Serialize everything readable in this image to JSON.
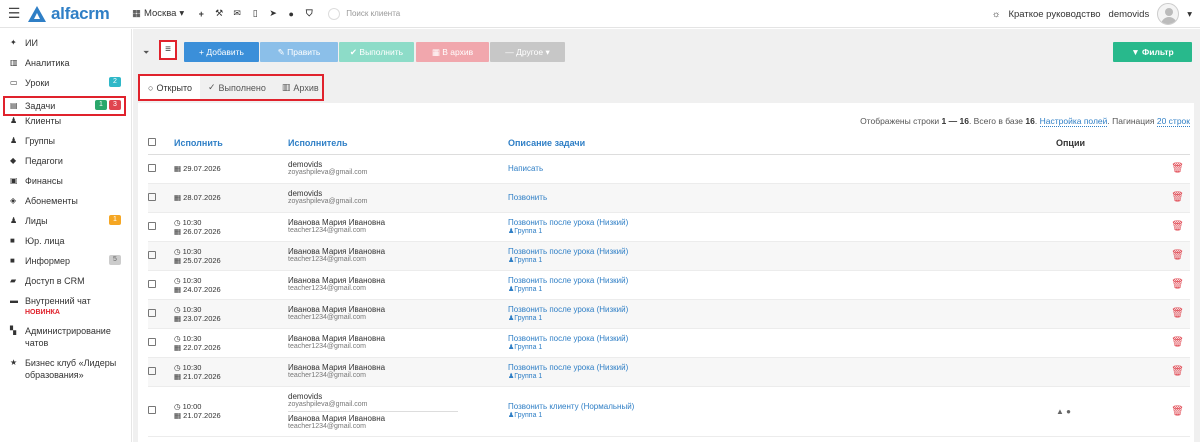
{
  "topbar": {
    "logo": "alfacrm",
    "city": "Москва",
    "search_placeholder": "Поиск клиента",
    "guide": "Краткое руководство",
    "user": "demovids"
  },
  "sidebar": {
    "items": [
      {
        "icon": "magic-icon",
        "label": "ИИ"
      },
      {
        "icon": "chart-icon",
        "label": "Аналитика"
      },
      {
        "icon": "lessons-icon",
        "label": "Уроки",
        "badge": "2"
      },
      {
        "icon": "tasks-icon",
        "label": "Задачи",
        "badge1": "1",
        "badge2": "3"
      },
      {
        "icon": "clients-icon",
        "label": "Клиенты"
      },
      {
        "icon": "groups-icon",
        "label": "Группы"
      },
      {
        "icon": "teachers-icon",
        "label": "Педагоги"
      },
      {
        "icon": "finance-icon",
        "label": "Финансы"
      },
      {
        "icon": "subscriptions-icon",
        "label": "Абонементы"
      },
      {
        "icon": "leads-icon",
        "label": "Лиды",
        "badge": "1"
      },
      {
        "icon": "legal-icon",
        "label": "Юр. лица"
      },
      {
        "icon": "informer-icon",
        "label": "Информер",
        "badge": "5"
      },
      {
        "icon": "access-icon",
        "label": "Доступ в CRM"
      },
      {
        "icon": "chat-icon",
        "label": "Внутренний чат",
        "sub": "НОВИНКА"
      },
      {
        "icon": "admin-icon",
        "label": "Администрирование чатов"
      },
      {
        "icon": "star-icon",
        "label": "Бизнес клуб «Лидеры образования»"
      }
    ]
  },
  "toolbar": {
    "add": "+ Добавить",
    "edit": "✎ Править",
    "done": "✔ Выполнить",
    "archive": "▦ В архив",
    "other": "— Другое ▾",
    "filter": "▼ Фильтр"
  },
  "tabs": {
    "open": "Открыто",
    "done": "Выполнено",
    "archive": "Архив"
  },
  "info": {
    "prefix": "Отображены строки",
    "range": "1 — 16",
    "total_prefix": ". Всего в базе",
    "total": "16",
    "fields_link": "Настройка полей",
    "pagination_prefix": "Пагинация",
    "pagination_link": "20 строк"
  },
  "columns": {
    "due": "Исполнить",
    "assignee": "Исполнитель",
    "description": "Описание задачи",
    "options": "Опции"
  },
  "rows": [
    {
      "time": "",
      "date": "29.07.2026",
      "name": "demovids",
      "email": "zoyashpileva@gmail.com",
      "desc": "Написать",
      "group": ""
    },
    {
      "time": "",
      "date": "28.07.2026",
      "name": "demovids",
      "email": "zoyashpileva@gmail.com",
      "desc": "Позвонить",
      "group": ""
    },
    {
      "time": "10:30",
      "date": "26.07.2026",
      "name": "Иванова Мария Ивановна",
      "email": "teacher1234@gmail.com",
      "desc": "Позвонить после урока (Низкий)",
      "group": "Группа 1"
    },
    {
      "time": "10:30",
      "date": "25.07.2026",
      "name": "Иванова Мария Ивановна",
      "email": "teacher1234@gmail.com",
      "desc": "Позвонить после урока (Низкий)",
      "group": "Группа 1"
    },
    {
      "time": "10:30",
      "date": "24.07.2026",
      "name": "Иванова Мария Ивановна",
      "email": "teacher1234@gmail.com",
      "desc": "Позвонить после урока (Низкий)",
      "group": "Группа 1"
    },
    {
      "time": "10:30",
      "date": "23.07.2026",
      "name": "Иванова Мария Ивановна",
      "email": "teacher1234@gmail.com",
      "desc": "Позвонить после урока (Низкий)",
      "group": "Группа 1"
    },
    {
      "time": "10:30",
      "date": "22.07.2026",
      "name": "Иванова Мария Ивановна",
      "email": "teacher1234@gmail.com",
      "desc": "Позвонить после урока (Низкий)",
      "group": "Группа 1"
    },
    {
      "time": "10:30",
      "date": "21.07.2026",
      "name": "Иванова Мария Ивановна",
      "email": "teacher1234@gmail.com",
      "desc": "Позвонить после урока (Низкий)",
      "group": "Группа 1"
    }
  ],
  "last_row": {
    "time": "10:00",
    "date": "21.07.2026",
    "name1": "demovids",
    "email1": "zoyashpileva@gmail.com",
    "name2": "Иванова Мария Ивановна",
    "email2": "teacher1234@gmail.com",
    "desc": "Позвонить клиенту (Нормальный)",
    "group": "Группа 1"
  }
}
